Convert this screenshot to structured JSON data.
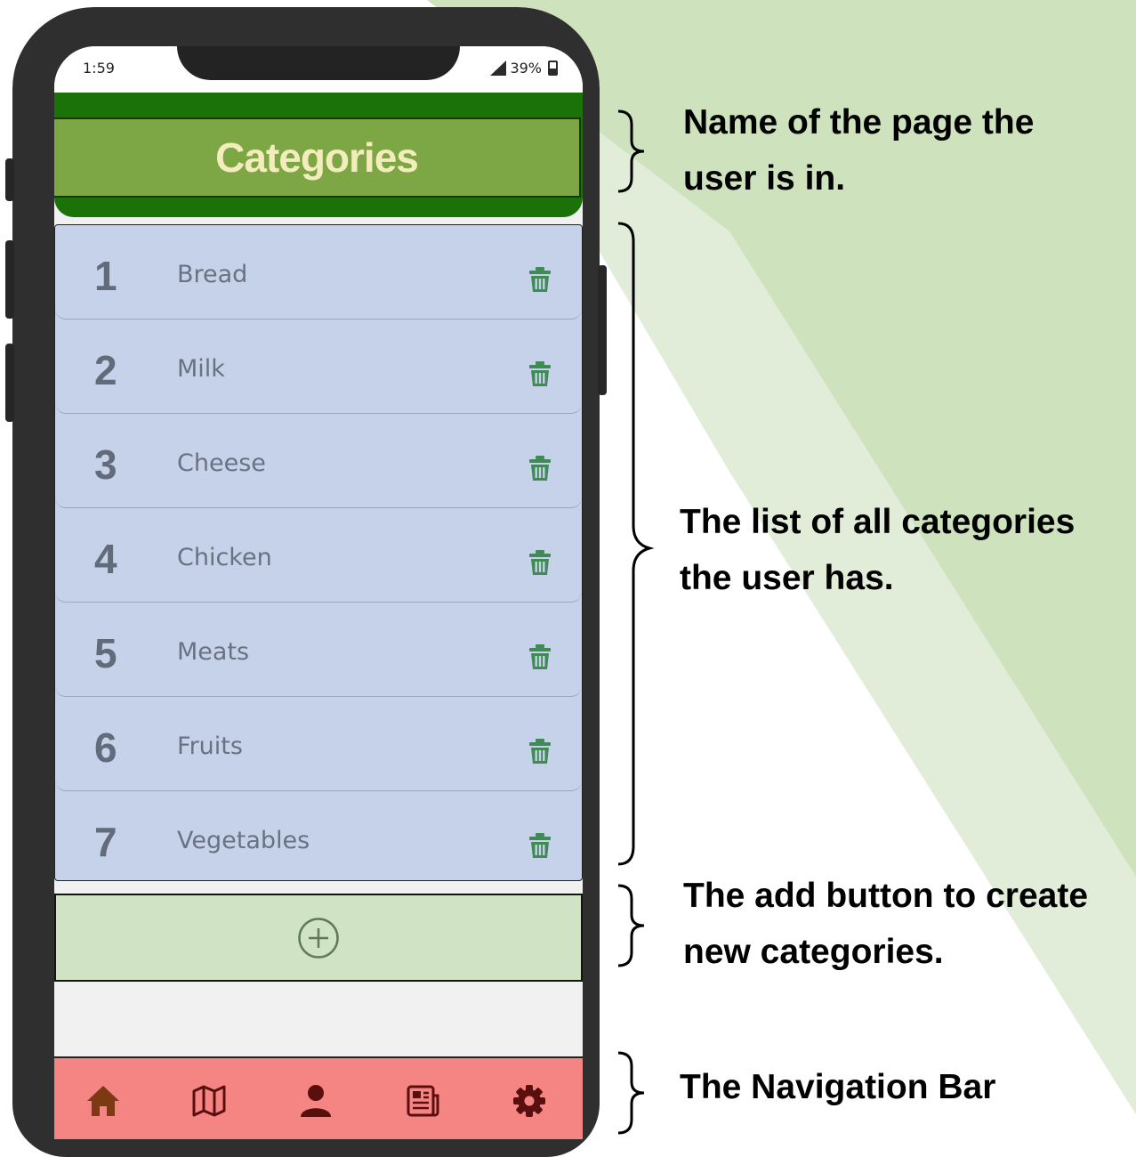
{
  "status_bar": {
    "time": "1:59",
    "battery": "39%"
  },
  "header": {
    "title": "Categories"
  },
  "categories": [
    {
      "number": "1",
      "label": "Bread"
    },
    {
      "number": "2",
      "label": "Milk"
    },
    {
      "number": "3",
      "label": "Cheese"
    },
    {
      "number": "4",
      "label": "Chicken"
    },
    {
      "number": "5",
      "label": "Meats"
    },
    {
      "number": "6",
      "label": "Fruits"
    },
    {
      "number": "7",
      "label": "Vegetables"
    }
  ],
  "add_button": {
    "icon": "plus-circle-icon"
  },
  "nav": {
    "items": [
      {
        "icon": "home-icon"
      },
      {
        "icon": "map-icon"
      },
      {
        "icon": "profile-icon"
      },
      {
        "icon": "news-icon"
      },
      {
        "icon": "settings-icon"
      }
    ]
  },
  "annotations": {
    "title_line1": "Name of the page the",
    "title_line2": "user is in.",
    "list_line1": "The list of all categories",
    "list_line2": "the user has.",
    "add_line1": "The add button to create",
    "add_line2": "new categories.",
    "nav_line1": "The Navigation Bar"
  },
  "colors": {
    "header_green": "#1a7208",
    "title_box": "#7da645",
    "title_text": "#f3ecbc",
    "list_bg": "#c6d2ea",
    "trash_green": "#3f8a55",
    "add_bg": "#d0e3c4",
    "nav_bg": "#f48583",
    "nav_icon_brown": "#7b3a14",
    "nav_icon_dark": "#5a0f0f"
  }
}
